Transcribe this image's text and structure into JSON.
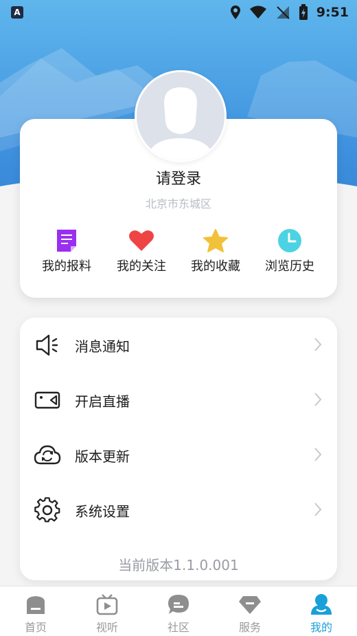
{
  "status_bar": {
    "time": "9:51",
    "app_badge": "A"
  },
  "profile": {
    "login_prompt": "请登录",
    "location": "北京市东城区"
  },
  "quick_actions": [
    {
      "label": "我的报料",
      "icon": "report-document-icon",
      "color": "#9a2ff0"
    },
    {
      "label": "我的关注",
      "icon": "heart-icon",
      "color": "#ef4444"
    },
    {
      "label": "我的收藏",
      "icon": "star-icon",
      "color": "#f2c13a"
    },
    {
      "label": "浏览历史",
      "icon": "clock-icon",
      "color": "#4bd3e3"
    }
  ],
  "menu": [
    {
      "label": "消息通知",
      "icon": "speaker-icon"
    },
    {
      "label": "开启直播",
      "icon": "video-camera-icon"
    },
    {
      "label": "版本更新",
      "icon": "cloud-sync-icon"
    },
    {
      "label": "系统设置",
      "icon": "gear-icon"
    }
  ],
  "version_text": "当前版本1.1.0.001",
  "tabs": [
    {
      "label": "首页",
      "icon": "home-icon",
      "active": false
    },
    {
      "label": "视听",
      "icon": "tv-play-icon",
      "active": false
    },
    {
      "label": "社区",
      "icon": "chat-bubble-icon",
      "active": false
    },
    {
      "label": "服务",
      "icon": "diamond-icon",
      "active": false
    },
    {
      "label": "我的",
      "icon": "person-icon",
      "active": true
    }
  ],
  "colors": {
    "accent": "#1aa0d8",
    "header": "#3f92df"
  }
}
